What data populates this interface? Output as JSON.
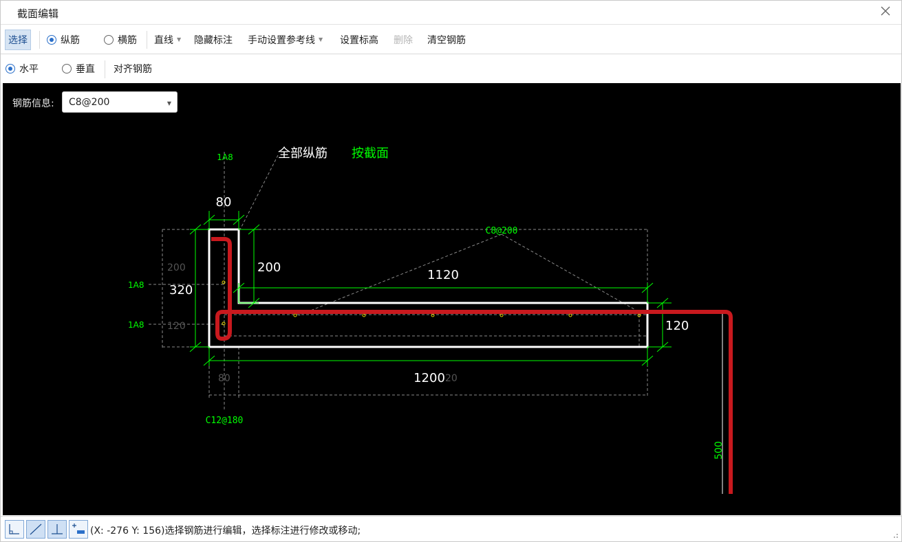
{
  "window": {
    "title": "截面编辑",
    "close_icon": "close-icon"
  },
  "toolbar1": {
    "select": "选择",
    "longitudinal": "纵筋",
    "transverse": "横筋",
    "line": "直线",
    "hide_annotation": "隐藏标注",
    "manual_reference": "手动设置参考线",
    "set_elevation": "设置标高",
    "delete": "删除",
    "clear_rebar": "清空钢筋"
  },
  "toolbar2": {
    "horizontal": "水平",
    "vertical": "垂直",
    "align_rebar": "对齐钢筋"
  },
  "rebar_info": {
    "label": "钢筋信息:",
    "value": "C8@200"
  },
  "drawing": {
    "callout_all_long": "全部纵筋",
    "callout_by_section": "按截面",
    "top_rebar": "1A8",
    "left_rebar_1": "1A8",
    "left_rebar_2": "1A8",
    "bottom_stirrup": "C12@180",
    "slab_rebar": "C8@200",
    "dim_80_top": "80",
    "dim_200_right": "200",
    "dim_200_left": "200",
    "dim_320": "320",
    "dim_120_left": "120",
    "dim_1120": "1120",
    "dim_120_right": "120",
    "dim_1200": "1200",
    "dim_80_bottom": "80",
    "dim_ghost_20": "20",
    "dim_500": "500"
  },
  "status": {
    "text": "(X: -276 Y: 156)选择钢筋进行编辑，选择标注进行修改或移动;"
  },
  "colors": {
    "canvas_bg": "#000000",
    "outline": "#ffffff",
    "dimension": "#00ff00",
    "rebar": "#c8191e",
    "guide": "#8a8a8a",
    "accent": "#2a6fc9"
  }
}
